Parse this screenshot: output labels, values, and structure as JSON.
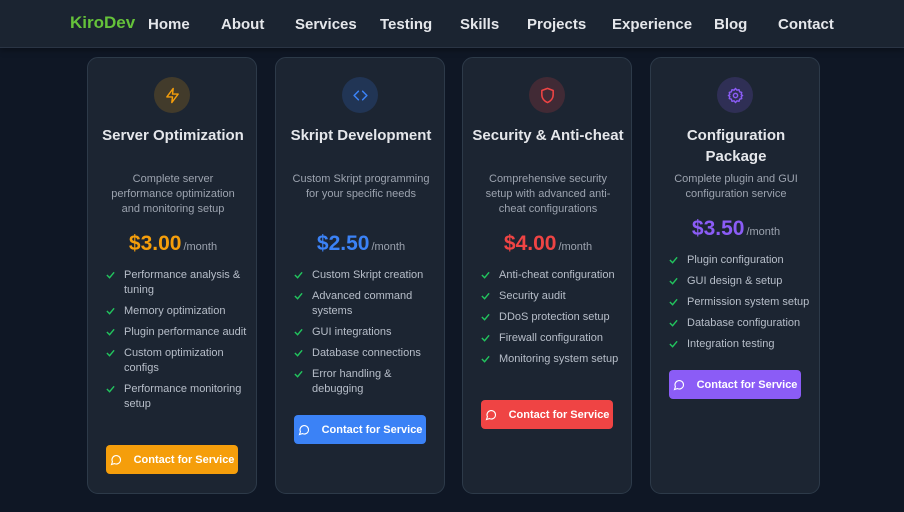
{
  "brand": "KiroDev",
  "nav": [
    "Home",
    "About",
    "Services",
    "Testing",
    "Skills",
    "Projects",
    "Experience",
    "Blog",
    "Contact"
  ],
  "cards": [
    {
      "icon": "lightning-icon",
      "accent": "#f59e0b",
      "title": "Server Optimization",
      "description": "Complete server performance optimization and monitoring setup",
      "price": "$3.00",
      "per": "/month",
      "features": [
        "Performance analysis & tuning",
        "Memory optimization",
        "Plugin performance audit",
        "Custom optimization configs",
        "Performance monitoring setup"
      ],
      "button": "Contact for Service"
    },
    {
      "icon": "code-icon",
      "accent": "#3b82f6",
      "title": "Skript Development",
      "description": "Custom Skript programming for your specific needs",
      "price": "$2.50",
      "per": "/month",
      "features": [
        "Custom Skript creation",
        "Advanced command systems",
        "GUI integrations",
        "Database connections",
        "Error handling & debugging"
      ],
      "button": "Contact for Service"
    },
    {
      "icon": "shield-icon",
      "accent": "#ef4444",
      "title": "Security & Anti-cheat",
      "description": "Comprehensive security setup with advanced anti-cheat configurations",
      "price": "$4.00",
      "per": "/month",
      "features": [
        "Anti-cheat configuration",
        "Security audit",
        "DDoS protection setup",
        "Firewall configuration",
        "Monitoring system setup"
      ],
      "button": "Contact for Service"
    },
    {
      "icon": "gear-icon",
      "accent": "#8b5cf6",
      "title": "Configuration Package",
      "description": "Complete plugin and GUI configuration service",
      "price": "$3.50",
      "per": "/month",
      "features": [
        "Plugin configuration",
        "GUI design & setup",
        "Permission system setup",
        "Database configuration",
        "Integration testing"
      ],
      "button": "Contact for Service"
    }
  ]
}
